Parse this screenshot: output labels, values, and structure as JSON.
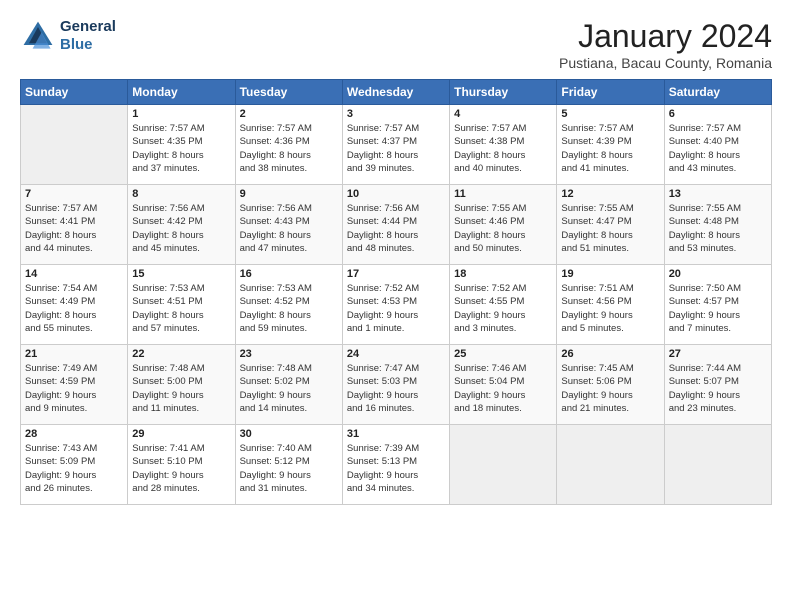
{
  "header": {
    "logo_line1": "General",
    "logo_line2": "Blue",
    "title": "January 2024",
    "subtitle": "Pustiana, Bacau County, Romania"
  },
  "weekdays": [
    "Sunday",
    "Monday",
    "Tuesday",
    "Wednesday",
    "Thursday",
    "Friday",
    "Saturday"
  ],
  "weeks": [
    [
      {
        "day": "",
        "info": ""
      },
      {
        "day": "1",
        "info": "Sunrise: 7:57 AM\nSunset: 4:35 PM\nDaylight: 8 hours\nand 37 minutes."
      },
      {
        "day": "2",
        "info": "Sunrise: 7:57 AM\nSunset: 4:36 PM\nDaylight: 8 hours\nand 38 minutes."
      },
      {
        "day": "3",
        "info": "Sunrise: 7:57 AM\nSunset: 4:37 PM\nDaylight: 8 hours\nand 39 minutes."
      },
      {
        "day": "4",
        "info": "Sunrise: 7:57 AM\nSunset: 4:38 PM\nDaylight: 8 hours\nand 40 minutes."
      },
      {
        "day": "5",
        "info": "Sunrise: 7:57 AM\nSunset: 4:39 PM\nDaylight: 8 hours\nand 41 minutes."
      },
      {
        "day": "6",
        "info": "Sunrise: 7:57 AM\nSunset: 4:40 PM\nDaylight: 8 hours\nand 43 minutes."
      }
    ],
    [
      {
        "day": "7",
        "info": "Sunrise: 7:57 AM\nSunset: 4:41 PM\nDaylight: 8 hours\nand 44 minutes."
      },
      {
        "day": "8",
        "info": "Sunrise: 7:56 AM\nSunset: 4:42 PM\nDaylight: 8 hours\nand 45 minutes."
      },
      {
        "day": "9",
        "info": "Sunrise: 7:56 AM\nSunset: 4:43 PM\nDaylight: 8 hours\nand 47 minutes."
      },
      {
        "day": "10",
        "info": "Sunrise: 7:56 AM\nSunset: 4:44 PM\nDaylight: 8 hours\nand 48 minutes."
      },
      {
        "day": "11",
        "info": "Sunrise: 7:55 AM\nSunset: 4:46 PM\nDaylight: 8 hours\nand 50 minutes."
      },
      {
        "day": "12",
        "info": "Sunrise: 7:55 AM\nSunset: 4:47 PM\nDaylight: 8 hours\nand 51 minutes."
      },
      {
        "day": "13",
        "info": "Sunrise: 7:55 AM\nSunset: 4:48 PM\nDaylight: 8 hours\nand 53 minutes."
      }
    ],
    [
      {
        "day": "14",
        "info": "Sunrise: 7:54 AM\nSunset: 4:49 PM\nDaylight: 8 hours\nand 55 minutes."
      },
      {
        "day": "15",
        "info": "Sunrise: 7:53 AM\nSunset: 4:51 PM\nDaylight: 8 hours\nand 57 minutes."
      },
      {
        "day": "16",
        "info": "Sunrise: 7:53 AM\nSunset: 4:52 PM\nDaylight: 8 hours\nand 59 minutes."
      },
      {
        "day": "17",
        "info": "Sunrise: 7:52 AM\nSunset: 4:53 PM\nDaylight: 9 hours\nand 1 minute."
      },
      {
        "day": "18",
        "info": "Sunrise: 7:52 AM\nSunset: 4:55 PM\nDaylight: 9 hours\nand 3 minutes."
      },
      {
        "day": "19",
        "info": "Sunrise: 7:51 AM\nSunset: 4:56 PM\nDaylight: 9 hours\nand 5 minutes."
      },
      {
        "day": "20",
        "info": "Sunrise: 7:50 AM\nSunset: 4:57 PM\nDaylight: 9 hours\nand 7 minutes."
      }
    ],
    [
      {
        "day": "21",
        "info": "Sunrise: 7:49 AM\nSunset: 4:59 PM\nDaylight: 9 hours\nand 9 minutes."
      },
      {
        "day": "22",
        "info": "Sunrise: 7:48 AM\nSunset: 5:00 PM\nDaylight: 9 hours\nand 11 minutes."
      },
      {
        "day": "23",
        "info": "Sunrise: 7:48 AM\nSunset: 5:02 PM\nDaylight: 9 hours\nand 14 minutes."
      },
      {
        "day": "24",
        "info": "Sunrise: 7:47 AM\nSunset: 5:03 PM\nDaylight: 9 hours\nand 16 minutes."
      },
      {
        "day": "25",
        "info": "Sunrise: 7:46 AM\nSunset: 5:04 PM\nDaylight: 9 hours\nand 18 minutes."
      },
      {
        "day": "26",
        "info": "Sunrise: 7:45 AM\nSunset: 5:06 PM\nDaylight: 9 hours\nand 21 minutes."
      },
      {
        "day": "27",
        "info": "Sunrise: 7:44 AM\nSunset: 5:07 PM\nDaylight: 9 hours\nand 23 minutes."
      }
    ],
    [
      {
        "day": "28",
        "info": "Sunrise: 7:43 AM\nSunset: 5:09 PM\nDaylight: 9 hours\nand 26 minutes."
      },
      {
        "day": "29",
        "info": "Sunrise: 7:41 AM\nSunset: 5:10 PM\nDaylight: 9 hours\nand 28 minutes."
      },
      {
        "day": "30",
        "info": "Sunrise: 7:40 AM\nSunset: 5:12 PM\nDaylight: 9 hours\nand 31 minutes."
      },
      {
        "day": "31",
        "info": "Sunrise: 7:39 AM\nSunset: 5:13 PM\nDaylight: 9 hours\nand 34 minutes."
      },
      {
        "day": "",
        "info": ""
      },
      {
        "day": "",
        "info": ""
      },
      {
        "day": "",
        "info": ""
      }
    ]
  ]
}
